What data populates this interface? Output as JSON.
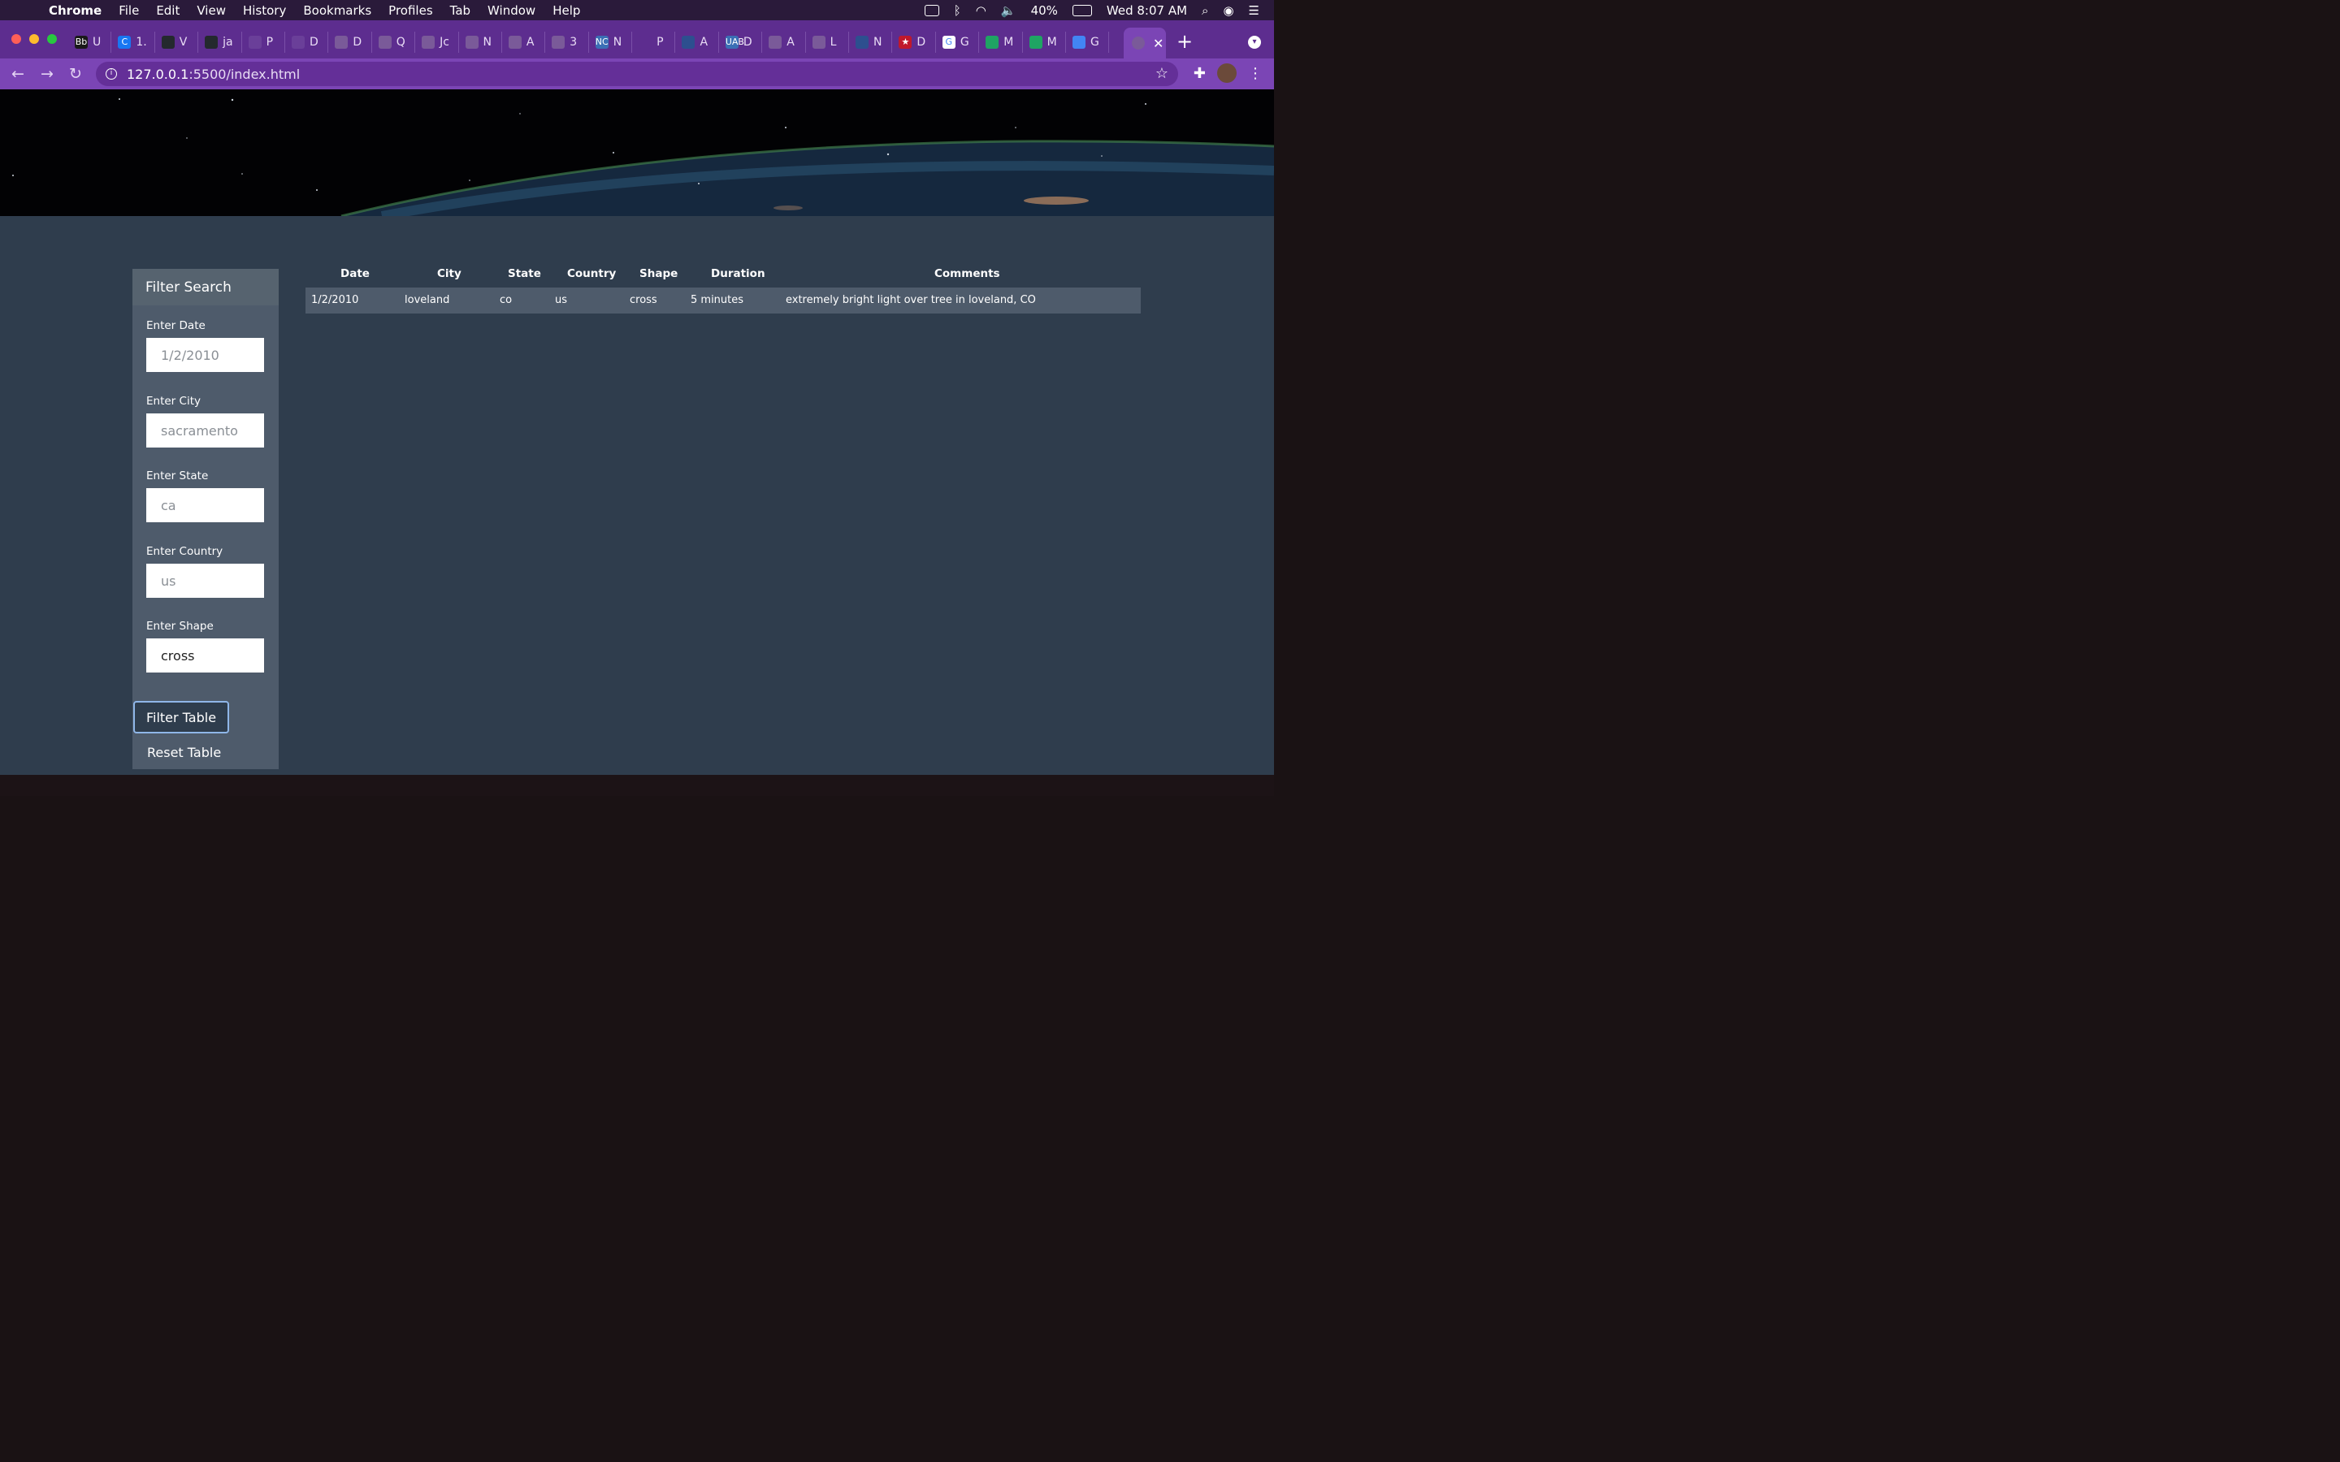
{
  "menubar": {
    "app": "Chrome",
    "items": [
      "File",
      "Edit",
      "View",
      "History",
      "Bookmarks",
      "Profiles",
      "Tab",
      "Window",
      "Help"
    ],
    "battery": "40%",
    "clock": "Wed 8:07 AM"
  },
  "tabs": [
    {
      "fav": "Bb",
      "label": "U",
      "color": "#1a1a1a"
    },
    {
      "fav": "C",
      "label": "1.",
      "color": "#1877f2"
    },
    {
      "fav": "",
      "label": "V",
      "color": "#24292e"
    },
    {
      "fav": "",
      "label": "ja",
      "color": "#24292e"
    },
    {
      "fav": "",
      "label": "P",
      "color": "#6a3f99"
    },
    {
      "fav": "",
      "label": "D",
      "color": "#6a3f99"
    },
    {
      "fav": "",
      "label": "D",
      "color": "#7a5a99"
    },
    {
      "fav": "",
      "label": "Q",
      "color": "#7a5a99"
    },
    {
      "fav": "",
      "label": "Jc",
      "color": "#7a5a99"
    },
    {
      "fav": "",
      "label": "N",
      "color": "#7a5a99"
    },
    {
      "fav": "",
      "label": "A",
      "color": "#7a5a99"
    },
    {
      "fav": "",
      "label": "3",
      "color": "#7a5a99"
    },
    {
      "fav": "NC",
      "label": "N",
      "color": "#3b6fb5"
    },
    {
      "fav": "",
      "label": "P",
      "color": "#5d2d8f"
    },
    {
      "fav": "",
      "label": "A",
      "color": "#2d4f8f"
    },
    {
      "fav": "UAB",
      "label": "D",
      "color": "#3b6fb5"
    },
    {
      "fav": "",
      "label": "A",
      "color": "#7a5a99"
    },
    {
      "fav": "",
      "label": "L",
      "color": "#7a5a99"
    },
    {
      "fav": "",
      "label": "N",
      "color": "#2d4f8f"
    },
    {
      "fav": "★",
      "label": "D",
      "color": "#c0182b"
    },
    {
      "fav": "G",
      "label": "G",
      "color": "#ffffff"
    },
    {
      "fav": "",
      "label": "M",
      "color": "#1fa463"
    },
    {
      "fav": "",
      "label": "M",
      "color": "#1fa463"
    },
    {
      "fav": "",
      "label": "G",
      "color": "#4285f4"
    }
  ],
  "active_tab": {
    "close": "✕"
  },
  "toolbar": {
    "url_host": "127.0.0.1",
    "url_rest": ":5500/index.html"
  },
  "sidebar": {
    "title": "Filter Search",
    "fields": [
      {
        "label": "Enter Date",
        "placeholder": "1/2/2010",
        "value": ""
      },
      {
        "label": "Enter City",
        "placeholder": "sacramento",
        "value": ""
      },
      {
        "label": "Enter State",
        "placeholder": "ca",
        "value": ""
      },
      {
        "label": "Enter Country",
        "placeholder": "us",
        "value": ""
      },
      {
        "label": "Enter Shape",
        "placeholder": "",
        "value": "cross"
      }
    ],
    "filter_button": "Filter Table",
    "reset_button": "Reset Table"
  },
  "table": {
    "headers": [
      "Date",
      "City",
      "State",
      "Country",
      "Shape",
      "Duration",
      "Comments"
    ],
    "rows": [
      [
        "1/2/2010",
        "loveland",
        "co",
        "us",
        "cross",
        "5 minutes",
        "extremely bright light over tree in loveland, CO"
      ]
    ]
  }
}
